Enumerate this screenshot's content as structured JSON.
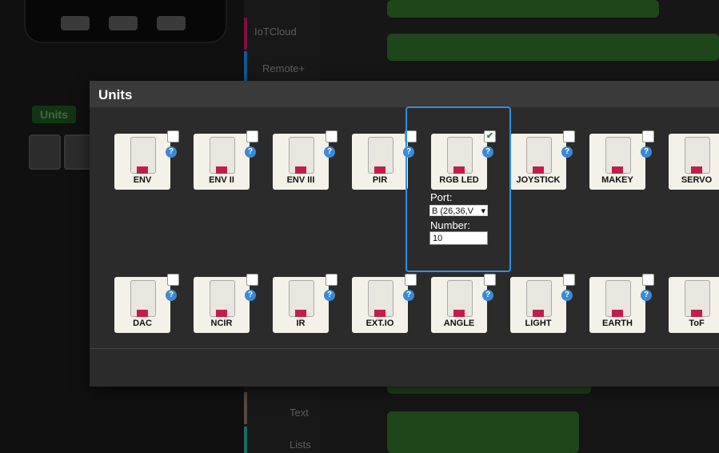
{
  "background": {
    "categories": [
      {
        "label": "IoTCloud",
        "color": "#c2185b"
      },
      {
        "label": "Remote+",
        "color": "#1e88e5"
      },
      {
        "label": "Text",
        "color": "#8d6e63"
      },
      {
        "label": "Lists",
        "color": "#26a69a"
      }
    ],
    "sidebar_tab": "Units"
  },
  "dialog": {
    "title": "Units",
    "help_glyph": "?",
    "check_glyph": "✔",
    "units": [
      {
        "name": "ENV",
        "checked": false
      },
      {
        "name": "ENV II",
        "checked": false
      },
      {
        "name": "ENV III",
        "checked": false
      },
      {
        "name": "PIR",
        "checked": false
      },
      {
        "name": "RGB LED",
        "checked": true
      },
      {
        "name": "JOYSTICK",
        "checked": false
      },
      {
        "name": "MAKEY",
        "checked": false
      },
      {
        "name": "SERVO",
        "checked": false
      },
      {
        "name": "DAC",
        "checked": false
      },
      {
        "name": "NCIR",
        "checked": false
      },
      {
        "name": "IR",
        "checked": false
      },
      {
        "name": "EXT.IO",
        "checked": false
      },
      {
        "name": "ANGLE",
        "checked": false
      },
      {
        "name": "LIGHT",
        "checked": false
      },
      {
        "name": "EARTH",
        "checked": false
      },
      {
        "name": "ToF",
        "checked": false
      }
    ],
    "selected_config": {
      "port_label": "Port:",
      "port_value": "B (26,36,V",
      "number_label": "Number:",
      "number_value": "10"
    }
  },
  "colors": {
    "accent": "#2f8fe6",
    "connector": "#c21d4a",
    "help": "#3a8ad6",
    "block_green": "#3c9c2e"
  }
}
